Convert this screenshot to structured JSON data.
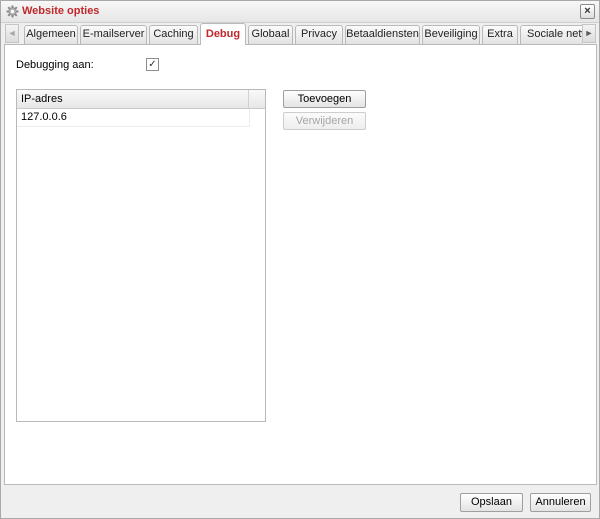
{
  "window": {
    "title": "Website opties",
    "close_label": "×"
  },
  "tabs": [
    {
      "label": "Algemeen",
      "active": false
    },
    {
      "label": "E-mailserver",
      "active": false
    },
    {
      "label": "Caching",
      "active": false
    },
    {
      "label": "Debug",
      "active": true
    },
    {
      "label": "Globaal",
      "active": false
    },
    {
      "label": "Privacy",
      "active": false
    },
    {
      "label": "Betaaldiensten",
      "active": false
    },
    {
      "label": "Beveiliging",
      "active": false
    },
    {
      "label": "Extra",
      "active": false
    },
    {
      "label": "Sociale netwe",
      "active": false
    }
  ],
  "scroll": {
    "left_icon": "◄",
    "right_icon": "►"
  },
  "debug": {
    "label": "Debugging aan:",
    "checked_mark": "✓"
  },
  "ip_grid": {
    "column": "IP-adres",
    "rows": [
      "127.0.0.6"
    ]
  },
  "buttons": {
    "add": "Toevoegen",
    "remove": "Verwijderen",
    "save": "Opslaan",
    "cancel": "Annuleren"
  },
  "colors": {
    "accent": "#c0282c"
  }
}
